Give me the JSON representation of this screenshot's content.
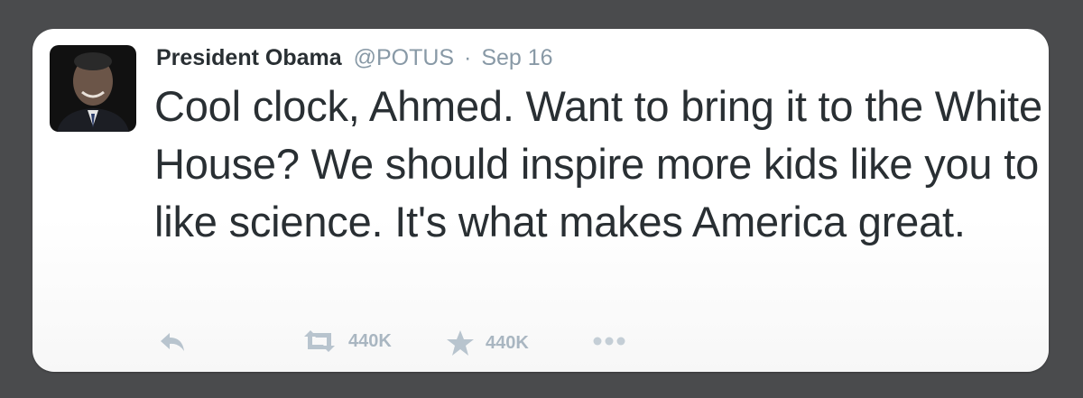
{
  "tweet": {
    "author_name": "President Obama",
    "handle": "@POTUS",
    "separator": "·",
    "date": "Sep 16",
    "text": "Cool clock, Ahmed. Want to bring it to the White House? We should inspire more kids like you to like science. It's what makes America great."
  },
  "actions": {
    "reply_icon": "reply-icon",
    "retweet_icon": "retweet-icon",
    "retweet_count": "440K",
    "favorite_icon": "star-icon",
    "favorite_count": "440K",
    "more_icon": "more-icon"
  },
  "colors": {
    "background": "#4a4b4d",
    "card": "#ffffff",
    "text": "#292f33",
    "muted": "#8899a6",
    "icon": "#b8c4ce"
  }
}
